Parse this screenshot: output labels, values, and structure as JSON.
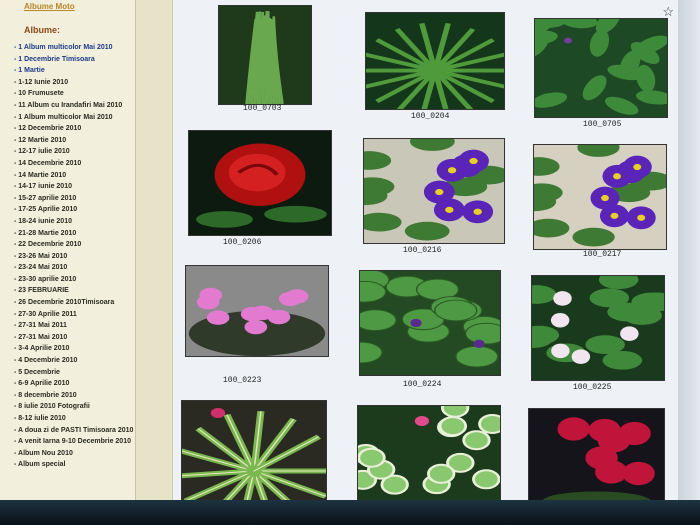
{
  "browser": {
    "star_icon": "star-icon"
  },
  "sidebar": {
    "top_links": [
      "",
      "Albume Moto"
    ],
    "title": "Albume:",
    "items": [
      {
        "label": "- 1 Album multicolor Mai 2010",
        "color": "blue"
      },
      {
        "label": "- 1 Decembrie Timisoara",
        "color": "blue"
      },
      {
        "label": "- 1 Martie",
        "color": "blue"
      },
      {
        "label": "- 1-12 Iunie 2010",
        "color": "dark"
      },
      {
        "label": "- 10 Frumusete",
        "color": "dark"
      },
      {
        "label": "- 11 Album cu Irandafiri Mai 2010",
        "color": "dark"
      },
      {
        "label": "- 1 Album multicolor Mai 2010",
        "color": "dark"
      },
      {
        "label": "- 12 Decembrie 2010",
        "color": "dark"
      },
      {
        "label": "- 12 Martie 2010",
        "color": "dark"
      },
      {
        "label": "- 12-17 iulie 2010",
        "color": "dark"
      },
      {
        "label": "- 14 Decembrie 2010",
        "color": "dark"
      },
      {
        "label": "- 14 Martie 2010",
        "color": "dark"
      },
      {
        "label": "- 14-17 iunie 2010",
        "color": "dark"
      },
      {
        "label": "- 15-27 aprilie 2010",
        "color": "dark"
      },
      {
        "label": "- 17-25 Aprilie 2010",
        "color": "dark"
      },
      {
        "label": "- 18-24 iunie 2010",
        "color": "dark"
      },
      {
        "label": "- 21-28 Martie 2010",
        "color": "dark"
      },
      {
        "label": "- 22 Decembrie 2010",
        "color": "dark"
      },
      {
        "label": "- 23-26 Mai 2010",
        "color": "dark"
      },
      {
        "label": "- 23-24 Mai 2010",
        "color": "dark"
      },
      {
        "label": "- 23-30 aprilie 2010",
        "color": "dark"
      },
      {
        "label": "- 23 FEBRUARIE",
        "color": "dark"
      },
      {
        "label": "- 26 Decembrie 2010Timisoara",
        "color": "dark"
      },
      {
        "label": "- 27-30 Aprilie 2011",
        "color": "dark"
      },
      {
        "label": "- 27-31 Mai 2011",
        "color": "dark"
      },
      {
        "label": "- 27-31 Mai 2010",
        "color": "dark"
      },
      {
        "label": "- 3-4 Aprilie 2010",
        "color": "dark"
      },
      {
        "label": "- 4 Decembrie 2010",
        "color": "dark"
      },
      {
        "label": "- 5 Decembrie",
        "color": "dark"
      },
      {
        "label": "- 6-9 Aprilie 2010",
        "color": "dark"
      },
      {
        "label": "- 8 decembrie 2010",
        "color": "dark"
      },
      {
        "label": "- 8 iulie 2010 Fotografii",
        "color": "dark"
      },
      {
        "label": "- 8-12 iulie 2010",
        "color": "dark"
      },
      {
        "label": "- A doua zi de PASTI Timisoara 2010",
        "color": "dark"
      },
      {
        "label": "- A venit Iarna 9-10 Decembrie 2010",
        "color": "dark"
      },
      {
        "label": "- Album Nou 2010",
        "color": "dark"
      },
      {
        "label": "- Album special",
        "color": "dark"
      }
    ]
  },
  "gallery": {
    "thumbnails": [
      {
        "caption": "100_0703",
        "kind": "grass"
      },
      {
        "caption": "100_0204",
        "kind": "spiky"
      },
      {
        "caption": "100_0705",
        "kind": "leafy"
      },
      {
        "caption": "100_0206",
        "kind": "rose"
      },
      {
        "caption": "100_0216",
        "kind": "violet-purple"
      },
      {
        "caption": "100_0217",
        "kind": "violet-purple2"
      },
      {
        "caption": "100_0223",
        "kind": "violet-pink"
      },
      {
        "caption": "100_0224",
        "kind": "violet-leaves"
      },
      {
        "caption": "100_0225",
        "kind": "violet-white"
      },
      {
        "caption": "",
        "kind": "striped"
      },
      {
        "caption": "",
        "kind": "variegated"
      },
      {
        "caption": "",
        "kind": "red-flowers"
      }
    ]
  },
  "colors": {
    "sidebar_bg": "#f2f0dc",
    "gallery_bg": "#eef2f6"
  }
}
